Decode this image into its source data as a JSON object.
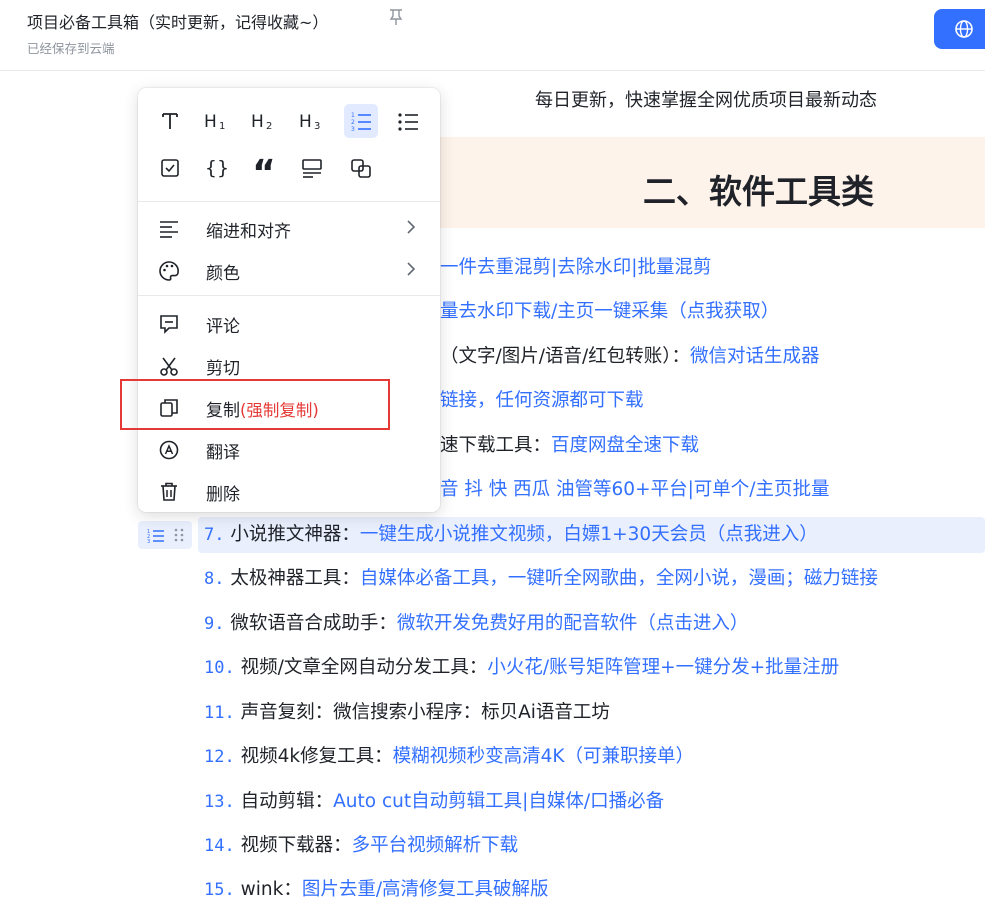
{
  "header": {
    "title": "项目必备工具箱（实时更新，记得收藏~）",
    "save_status": "已经保存到云端"
  },
  "document": {
    "subtitle": "每日更新，快速掌握全网优质项目最新动态",
    "section_heading": "二、软件工具类",
    "partial_rows": [
      "一件去重混剪|去除水印|批量混剪",
      "量去水印下载/主页一键采集（点我获取）",
      "（文字/图片/语音/红包转账）：",
      "微信对话生成器",
      "链接，任何资源都可下载",
      "速下载工具：",
      "百度网盘全速下载",
      "音 抖 快 西瓜 油管等60+平台|可单个/主页批量"
    ],
    "items": [
      {
        "num": "7.",
        "label": "小说推文神器：",
        "link": "一键生成小说推文视频，白嫖1+30天会员（点我进入）"
      },
      {
        "num": "8.",
        "label": "太极神器工具：",
        "link": "自媒体必备工具，一键听全网歌曲，全网小说，漫画；磁力链接"
      },
      {
        "num": "9.",
        "label": "微软语音合成助手：",
        "link": "微软开发免费好用的配音软件（点击进入）"
      },
      {
        "num": "10.",
        "label": "视频/文章全网自动分发工具：",
        "link": "小火花/账号矩阵管理+一键分发+批量注册"
      },
      {
        "num": "11.",
        "label": "声音复刻：微信搜索小程序：标贝Ai语音工坊",
        "link": ""
      },
      {
        "num": "12.",
        "label": "视频4k修复工具：",
        "link": "模糊视频秒变高清4K（可兼职接单）"
      },
      {
        "num": "13.",
        "label": "自动剪辑：",
        "link": "Auto cut自动剪辑工具|自媒体/口播必备"
      },
      {
        "num": "14.",
        "label": "视频下载器：",
        "link": "多平台视频解析下载"
      },
      {
        "num": "15.",
        "label": "wink：",
        "link": "图片去重/高清修复工具破解版"
      }
    ]
  },
  "context_menu": {
    "format_row1": [
      "T",
      "H1",
      "H2",
      "H3",
      "ordered-list",
      "bullet-list"
    ],
    "format_row2": [
      "checkbox",
      "{}",
      "“",
      "callout",
      "sync-block"
    ],
    "icons": {
      "text": "text-icon",
      "h1": "heading1-icon",
      "h2": "heading2-icon",
      "h3": "heading3-icon",
      "ordered": "ordered-list-icon",
      "bullet": "bullet-list-icon",
      "todo": "checkbox-icon",
      "code": "code-block-icon",
      "quote": "quote-icon",
      "callout": "callout-icon",
      "sync": "sync-block-icon"
    },
    "items": {
      "indent": "缩进和对齐",
      "color": "颜色",
      "comment": "评论",
      "cut": "剪切",
      "copy": "复制",
      "copy_force": "(强制复制)",
      "translate": "翻译",
      "delete": "删除"
    }
  },
  "colors": {
    "accent": "#3370ff",
    "highlight_box": "#e53935",
    "section_band": "#fdf3ea"
  }
}
